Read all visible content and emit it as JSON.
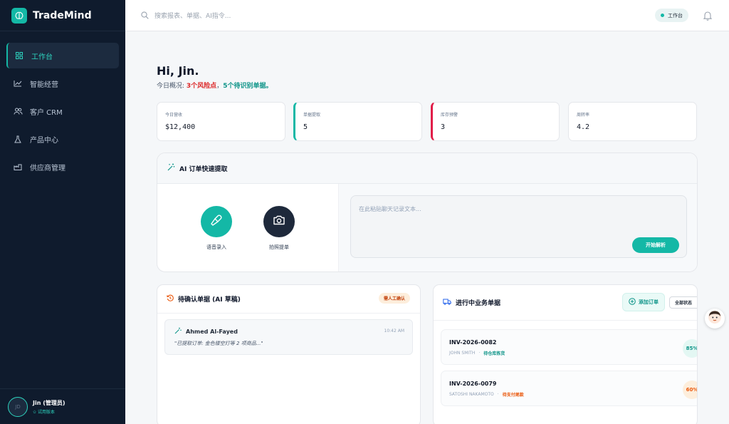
{
  "app": {
    "name": "TradeMind"
  },
  "sidebar": {
    "items": [
      {
        "label": "工作台",
        "icon": "grid-icon",
        "active": true
      },
      {
        "label": "智能经营",
        "icon": "trend-chart-icon"
      },
      {
        "label": "客户 CRM",
        "icon": "users-icon"
      },
      {
        "label": "产品中心",
        "icon": "flask-icon"
      },
      {
        "label": "供应商管理",
        "icon": "factory-icon"
      }
    ],
    "user": {
      "avatar": "JD",
      "name": "Jin (管理员)",
      "tag": "✩ 试用版本"
    }
  },
  "header": {
    "search_placeholder": "搜索报表、单据、AI指令...",
    "workspace_badge": "工作台"
  },
  "greeting": {
    "title": "Hi, Jin.",
    "prefix": "今日概况: ",
    "risk": "3个风险点",
    "sep": "，",
    "pending": "5个待识别单据。"
  },
  "stats": [
    {
      "label": "今日营收",
      "value": "$12,400"
    },
    {
      "label": "单据提取",
      "value": "5"
    },
    {
      "label": "库存预警",
      "value": "3"
    },
    {
      "label": "周转率",
      "value": "4.2"
    }
  ],
  "ai_card": {
    "title": "AI 订单快速提取",
    "voice_label": "语音录入",
    "photo_label": "拍照提单",
    "chat_placeholder": "在此粘贴聊天记录文本...",
    "parse_button": "开始解析"
  },
  "drafts": {
    "title": "待确认单据 (AI 草稿)",
    "badge": "需人工确认",
    "items": [
      {
        "name": "Ahmed Al-Fayed",
        "time": "10:42 AM",
        "quote": "\"已提取订单: 金色镂空灯等 2 项商品...\""
      }
    ]
  },
  "orders": {
    "title": "进行中业务单据",
    "add_button": "添加订单",
    "status_filter": "全部状态",
    "items": [
      {
        "id": "INV-2026-0082",
        "customer": "JOHN SMITH",
        "status": "待仓库拣货",
        "progress": "85%"
      },
      {
        "id": "INV-2026-0079",
        "customer": "SATOSHI NAKAMOTO",
        "status": "待支付尾款",
        "progress": "60%"
      }
    ]
  },
  "colors": {
    "accent": "#14b8a6",
    "sidebar_bg": "#0f1b2d",
    "risk": "#dc2626",
    "warning": "#ea580c"
  }
}
